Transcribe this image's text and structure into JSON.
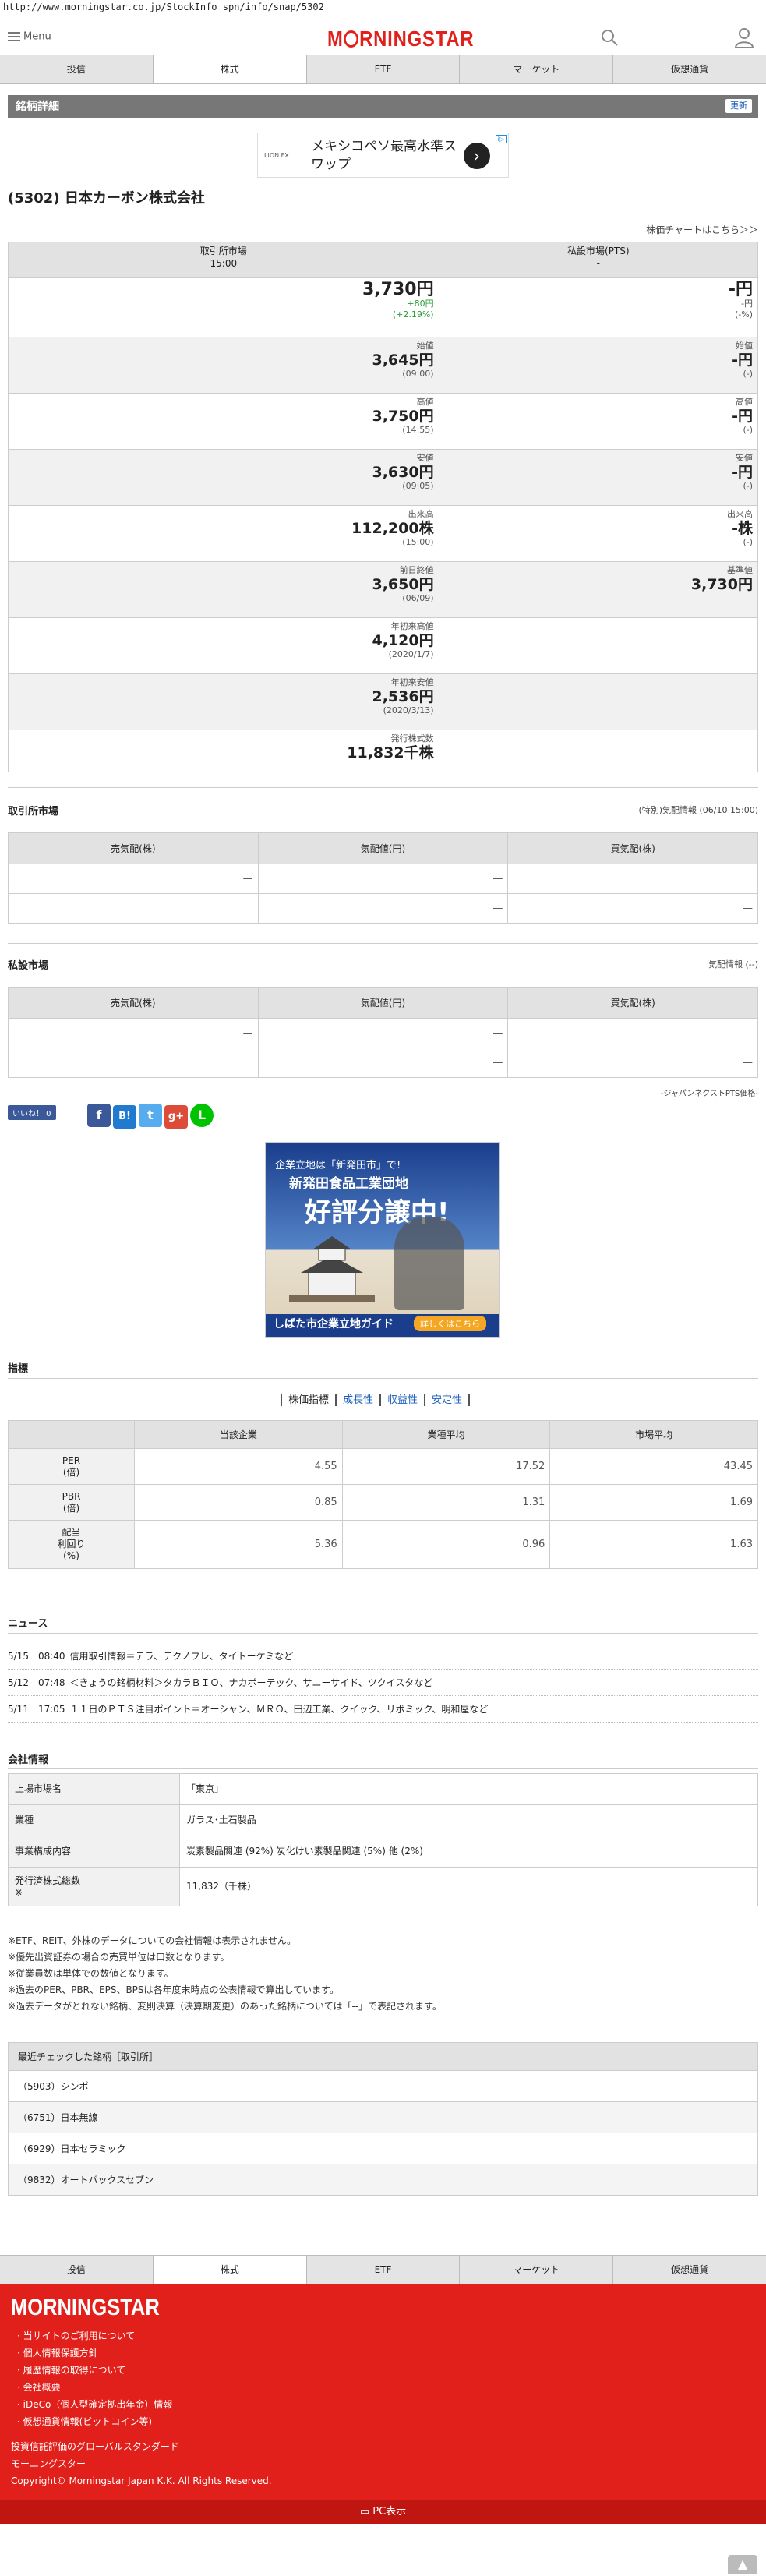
{
  "url": "http://www.morningstar.co.jp/StockInfo_spn/info/snap/5302",
  "header": {
    "menu_label": "Menu",
    "logo_text": "MORNINGSTAR"
  },
  "tabs": [
    "投信",
    "株式",
    "ETF",
    "マーケット",
    "仮想通貨"
  ],
  "active_tab": "株式",
  "section_title": "銘柄詳細",
  "refresh_label": "更新",
  "ad_top": {
    "text": "メキシコペソ最高水準スワップ",
    "brand": "LION FX"
  },
  "stock_title": "(5302) 日本カーボン株式会社",
  "chart_link": "株価チャートはこちら＞＞",
  "price_table": {
    "col1_header": "取引所市場",
    "col1_sub": "15:00",
    "col2_header": "私設市場(PTS)",
    "col2_sub": "-",
    "rows": [
      {
        "l_label": "",
        "l_value": "3,730円",
        "l_sub1": "+80円",
        "l_sub2": "(+2.19%)",
        "r_label": "",
        "r_value": "-円",
        "r_sub1": "-円",
        "r_sub2": "(-%)"
      },
      {
        "l_label": "始値",
        "l_value": "3,645円",
        "l_sub1": "(09:00)",
        "r_label": "始値",
        "r_value": "-円",
        "r_sub1": "(-)"
      },
      {
        "l_label": "高値",
        "l_value": "3,750円",
        "l_sub1": "(14:55)",
        "r_label": "高値",
        "r_value": "-円",
        "r_sub1": "(-)"
      },
      {
        "l_label": "安値",
        "l_value": "3,630円",
        "l_sub1": "(09:05)",
        "r_label": "安値",
        "r_value": "-円",
        "r_sub1": "(-)"
      },
      {
        "l_label": "出来高",
        "l_value": "112,200株",
        "l_sub1": "(15:00)",
        "r_label": "出来高",
        "r_value": "-株",
        "r_sub1": "(-)"
      },
      {
        "l_label": "前日終値",
        "l_value": "3,650円",
        "l_sub1": "(06/09)",
        "r_label": "基準値",
        "r_value": "3,730円",
        "r_sub1": ""
      },
      {
        "l_label": "年初来高値",
        "l_value": "4,120円",
        "l_sub1": "(2020/1/7)"
      },
      {
        "l_label": "年初来安値",
        "l_value": "2,536円",
        "l_sub1": "(2020/3/13)"
      },
      {
        "l_label": "発行株式数",
        "l_value": "11,832千株",
        "l_sub1": ""
      }
    ]
  },
  "board1": {
    "title": "取引所市場",
    "note": "(特別)気配情報 (06/10 15:00)",
    "headers": [
      "売気配(株)",
      "気配値(円)",
      "買気配(株)"
    ],
    "rows": [
      [
        "—",
        "—",
        ""
      ],
      [
        "",
        "—",
        "—"
      ]
    ]
  },
  "board2": {
    "title": "私設市場",
    "note": "気配情報 (--)",
    "headers": [
      "売気配(株)",
      "気配値(円)",
      "買気配(株)"
    ],
    "rows": [
      [
        "—",
        "—",
        ""
      ],
      [
        "",
        "—",
        "—"
      ]
    ],
    "footnote": "-ジャパンネクストPTS価格-"
  },
  "share": {
    "like_label": "いいね！ 0"
  },
  "ad_mid": {
    "line1": "企業立地は「新発田市」で!",
    "line2": "新発田食品工業団地",
    "line3": "好評分譲中!",
    "line4": "しばた市企業立地ガイド",
    "button": "詳しくはこちら"
  },
  "indicators": {
    "title": "指標",
    "nav": [
      "株価指標",
      "成長性",
      "収益性",
      "安定性"
    ],
    "headers": [
      "",
      "当該企業",
      "業種平均",
      "市場平均"
    ],
    "rows": [
      {
        "label": "PER\n(倍)",
        "values": [
          "4.55",
          "17.52",
          "43.45"
        ]
      },
      {
        "label": "PBR\n(倍)",
        "values": [
          "0.85",
          "1.31",
          "1.69"
        ]
      },
      {
        "label": "配当\n利回り\n(%)",
        "values": [
          "5.36",
          "0.96",
          "1.63"
        ]
      }
    ]
  },
  "news": {
    "title": "ニュース",
    "items": [
      {
        "date": "5/15　08:40",
        "text": "信用取引情報＝テラ、テクノフレ、タイトーケミなど"
      },
      {
        "date": "5/12　07:48",
        "text": "＜きょうの銘柄材料＞タカラＢＩＯ、ナカボーテック、サニーサイド、ツクイスタなど"
      },
      {
        "date": "5/11　17:05",
        "text": "１１日のＰＴＳ注目ポイント＝オーシャン、ＭＲＯ、田辺工業、クイック、リボミック、明和屋など"
      }
    ]
  },
  "company": {
    "title": "会社情報",
    "rows": [
      {
        "k": "上場市場名",
        "v": "「東京」"
      },
      {
        "k": "業種",
        "v": "ガラス･土石製品"
      },
      {
        "k": "事業構成内容",
        "v": "炭素製品関連 (92%) 炭化けい素製品関連 (5%) 他 (2%)"
      },
      {
        "k": "発行済株式総数\n※",
        "v": "11,832（千株）"
      }
    ]
  },
  "notes": [
    "※ETF、REIT、外株のデータについての会社情報は表示されません。",
    "※優先出資証券の場合の売買単位は口数となります。",
    "※従業員数は単体での数値となります。",
    "※過去のPER、PBR、EPS、BPSは各年度末時点の公表情報で算出しています。",
    "※過去データがとれない銘柄、変則決算（決算期変更）のあった銘柄については「--」で表記されます。"
  ],
  "recent": {
    "title": "最近チェックした銘柄［取引所］",
    "items": [
      "（5903）シンポ",
      "（6751）日本無線",
      "（6929）日本セラミック",
      "（9832）オートバックスセブン"
    ]
  },
  "footer": {
    "logo": "MORNINGSTAR",
    "links": [
      "当サイトのご利用について",
      "個人情報保護方針",
      "履歴情報の取得について",
      "会社概要",
      "iDeCo（個人型確定拠出年金）情報",
      "仮想通貨情報(ビットコイン等)"
    ],
    "line1": "投資信託評価のグローバルスタンダード",
    "line2": "モーニングスター",
    "copyright": "Copyright© Morningstar Japan K.K. All Rights Reserved.",
    "pc_label": "PC表示"
  }
}
